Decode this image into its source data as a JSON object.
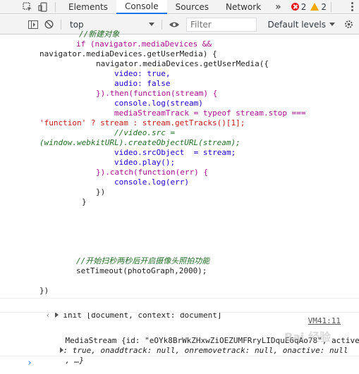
{
  "tabs": [
    "Elements",
    "Console",
    "Sources",
    "Network"
  ],
  "more_tabs": "»",
  "error_count": "2",
  "warning_count": "2",
  "context": "top",
  "filter_placeholder": "Filter",
  "levels": "Default levels",
  "code_lines": [
    "//新建对象",
    "if (navigator.mediaDevices &&",
    "navigator.mediaDevices.getUserMedia) {",
    "navigator.mediaDevices.getUserMedia({",
    "video: true,",
    "audio: false",
    "}).then(function(stream) {",
    "console.log(stream)",
    "mediaStreamTrack = typeof stream.stop ===",
    "'function' ? stream : stream.getTracks()[1];",
    "//video.src =",
    "(window.webkitURL).createObjectURL(stream);",
    "video.srcObject  = stream;",
    "video.play();",
    "}).catch(function(err) {",
    "console.log(err)",
    "})",
    "}",
    "//开始扫秒两秒后开启摄像头照拍功能",
    "setTimeout(photoGraph,2000);",
    "})"
  ],
  "result": "init [document, context: document]",
  "source_link": "VM41:11",
  "mediastream_lines": [
    "MediaStream {id: \"eOYk8BrWkZHxwZiOEZUMFRryLIDquE6qAo78\", active",
    ": true, onaddtrack: null, onremovetrack: null, onactive: null",
    ", …}"
  ],
  "watermark": "Bai 经验",
  "prompt_glyph": "›",
  "colors": {
    "keyword": "#aa0d91",
    "comment": "#236e25",
    "string": "#c41a16",
    "link_blue": "#1a73e8",
    "error": "#e51a1a",
    "warning": "#f2a600"
  }
}
